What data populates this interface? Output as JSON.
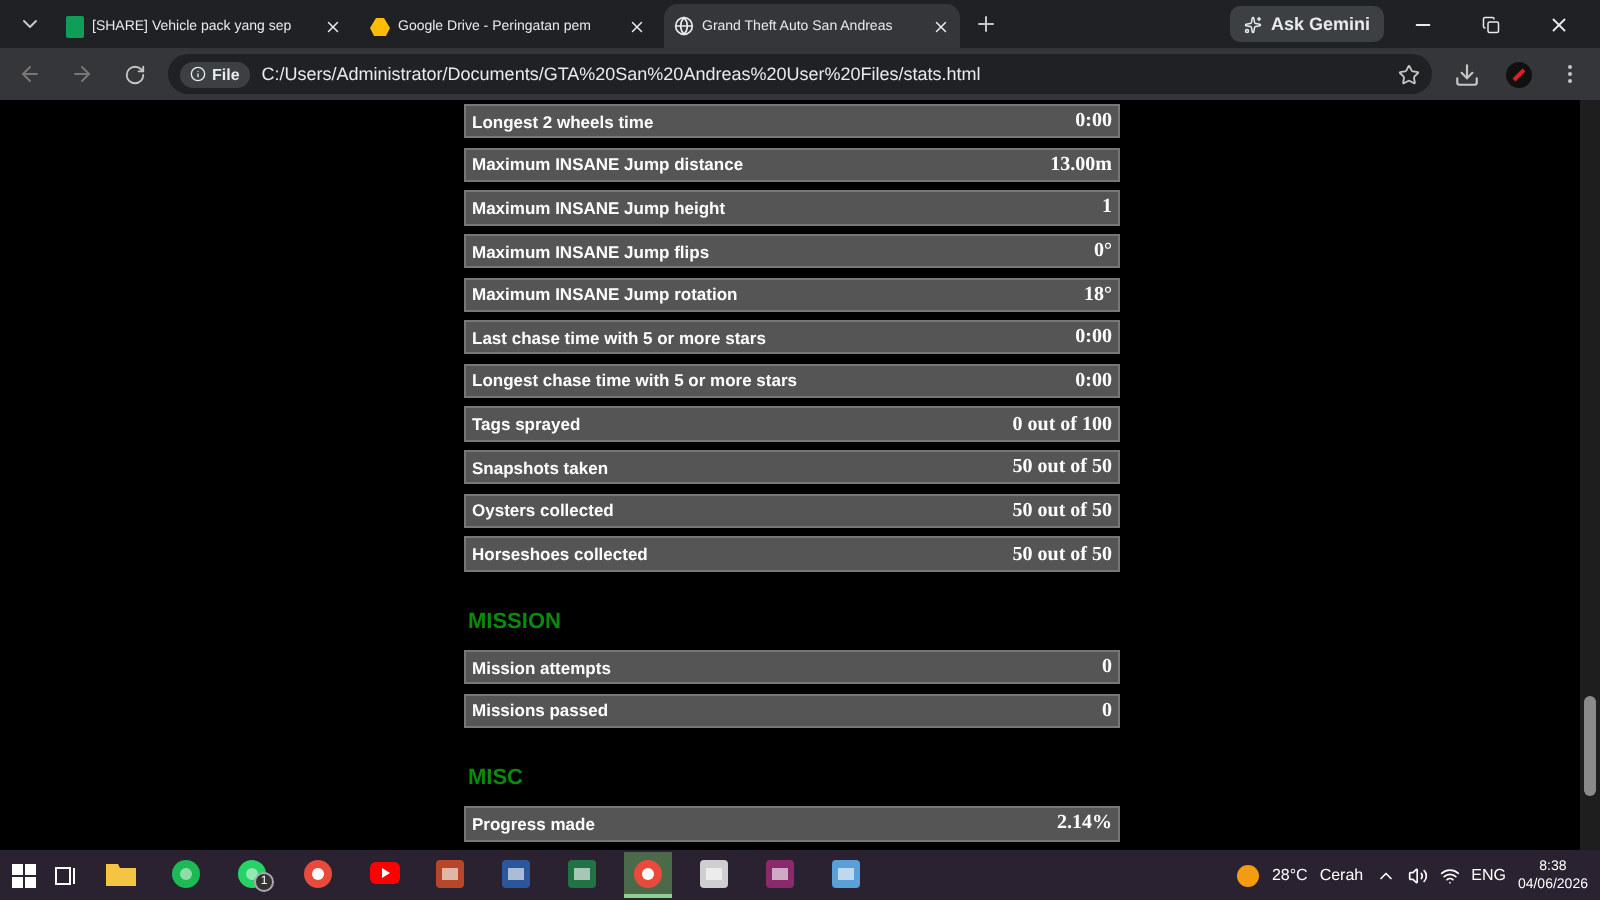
{
  "browser": {
    "tabs": [
      {
        "title": "[SHARE] Vehicle pack yang sep",
        "kind": "sheet",
        "selected": false
      },
      {
        "title": "Google Drive - Peringatan pem",
        "kind": "drive",
        "selected": false
      },
      {
        "title": "Grand Theft Auto San Andreas",
        "kind": "file",
        "selected": true
      }
    ],
    "ask_button": "Ask Gemini",
    "scheme_chip": "File",
    "url": "C:/Users/Administrator/Documents/GTA%20San%20Andreas%20User%20Files/stats.html"
  },
  "sections": [
    {
      "rows": [
        {
          "label": "Longest 2 wheels time",
          "value": "0:00"
        },
        {
          "label": "Maximum INSANE Jump distance",
          "value": "13.00m"
        },
        {
          "label": "Maximum INSANE Jump height",
          "value": "1"
        },
        {
          "label": "Maximum INSANE Jump flips",
          "value": "0°"
        },
        {
          "label": "Maximum INSANE Jump rotation",
          "value": "18°"
        },
        {
          "label": "Last chase time with 5 or more stars",
          "value": "0:00"
        },
        {
          "label": "Longest chase time with 5 or more stars",
          "value": "0:00"
        },
        {
          "label": "Tags sprayed",
          "value": "0 out of 100"
        },
        {
          "label": "Snapshots taken",
          "value": "50 out of 50"
        },
        {
          "label": "Oysters collected",
          "value": "50 out of 50"
        },
        {
          "label": "Horseshoes collected",
          "value": "50 out of 50"
        }
      ]
    },
    {
      "title": "MISSION",
      "rows": [
        {
          "label": "Mission attempts",
          "value": "0"
        },
        {
          "label": "Missions passed",
          "value": "0"
        }
      ]
    },
    {
      "title": "MISC",
      "rows": [
        {
          "label": "Progress made",
          "value": "2.14%"
        }
      ]
    }
  ],
  "taskbar": {
    "apps": [
      {
        "kind": "explorer",
        "selected": false
      },
      {
        "kind": "spotify",
        "selected": false
      },
      {
        "kind": "whatsapp",
        "selected": false,
        "badge": "1"
      },
      {
        "kind": "chrome",
        "selected": false
      },
      {
        "kind": "youtube",
        "selected": false
      },
      {
        "kind": "access",
        "selected": false
      },
      {
        "kind": "word",
        "selected": false
      },
      {
        "kind": "excel",
        "selected": false
      },
      {
        "kind": "chrome",
        "selected": true
      },
      {
        "kind": "printer",
        "selected": false
      },
      {
        "kind": "archive",
        "selected": false
      },
      {
        "kind": "photos",
        "selected": false
      }
    ],
    "weather": {
      "temp": "28°C",
      "condition": "Cerah"
    },
    "language": "ENG",
    "time": "8:38",
    "date": "04/06/2026"
  }
}
